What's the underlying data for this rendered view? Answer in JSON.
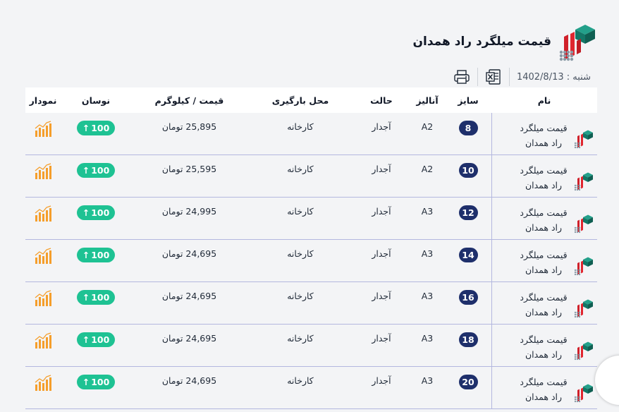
{
  "header": {
    "title": "قیمت میلگرد راد همدان"
  },
  "subbar": {
    "date": "شنبه : 1402/8/13",
    "excel_icon": "excel-icon",
    "print_icon": "printer-icon"
  },
  "table": {
    "columns": {
      "name": "نام",
      "size": "سایز",
      "analysis": "آنالیز",
      "state": "حالت",
      "place": "محل بارگیری",
      "price": "قیمت / کیلوگرم",
      "swing": "نوسان",
      "chart": "نمودار"
    },
    "rows": [
      {
        "name": "قیمت میلگرد راد همدان",
        "size": "8",
        "analysis": "A2",
        "state": "آجدار",
        "place": "کارخانه",
        "price": "25,895 تومان",
        "swing": "100"
      },
      {
        "name": "قیمت میلگرد راد همدان",
        "size": "10",
        "analysis": "A2",
        "state": "آجدار",
        "place": "کارخانه",
        "price": "25,595 تومان",
        "swing": "100"
      },
      {
        "name": "قیمت میلگرد راد همدان",
        "size": "12",
        "analysis": "A3",
        "state": "آجدار",
        "place": "کارخانه",
        "price": "24,995 تومان",
        "swing": "100"
      },
      {
        "name": "قیمت میلگرد راد همدان",
        "size": "14",
        "analysis": "A3",
        "state": "آجدار",
        "place": "کارخانه",
        "price": "24,695 تومان",
        "swing": "100"
      },
      {
        "name": "قیمت میلگرد راد همدان",
        "size": "16",
        "analysis": "A3",
        "state": "آجدار",
        "place": "کارخانه",
        "price": "24,695 تومان",
        "swing": "100"
      },
      {
        "name": "قیمت میلگرد راد همدان",
        "size": "18",
        "analysis": "A3",
        "state": "آجدار",
        "place": "کارخانه",
        "price": "24,695 تومان",
        "swing": "100"
      },
      {
        "name": "قیمت میلگرد راد همدان",
        "size": "20",
        "analysis": "A3",
        "state": "آجدار",
        "place": "کارخانه",
        "price": "24,695 تومان",
        "swing": "100"
      }
    ]
  },
  "colors": {
    "size_badge": "#1e2f6b",
    "swing_badge": "#1ec293",
    "chart_icon": "#f59e2b",
    "divider": "#b3b7df"
  },
  "icons": {
    "swing_arrow": "up-arrow-icon",
    "chart": "bar-chart-icon",
    "brand": "rebar-logo-icon"
  }
}
